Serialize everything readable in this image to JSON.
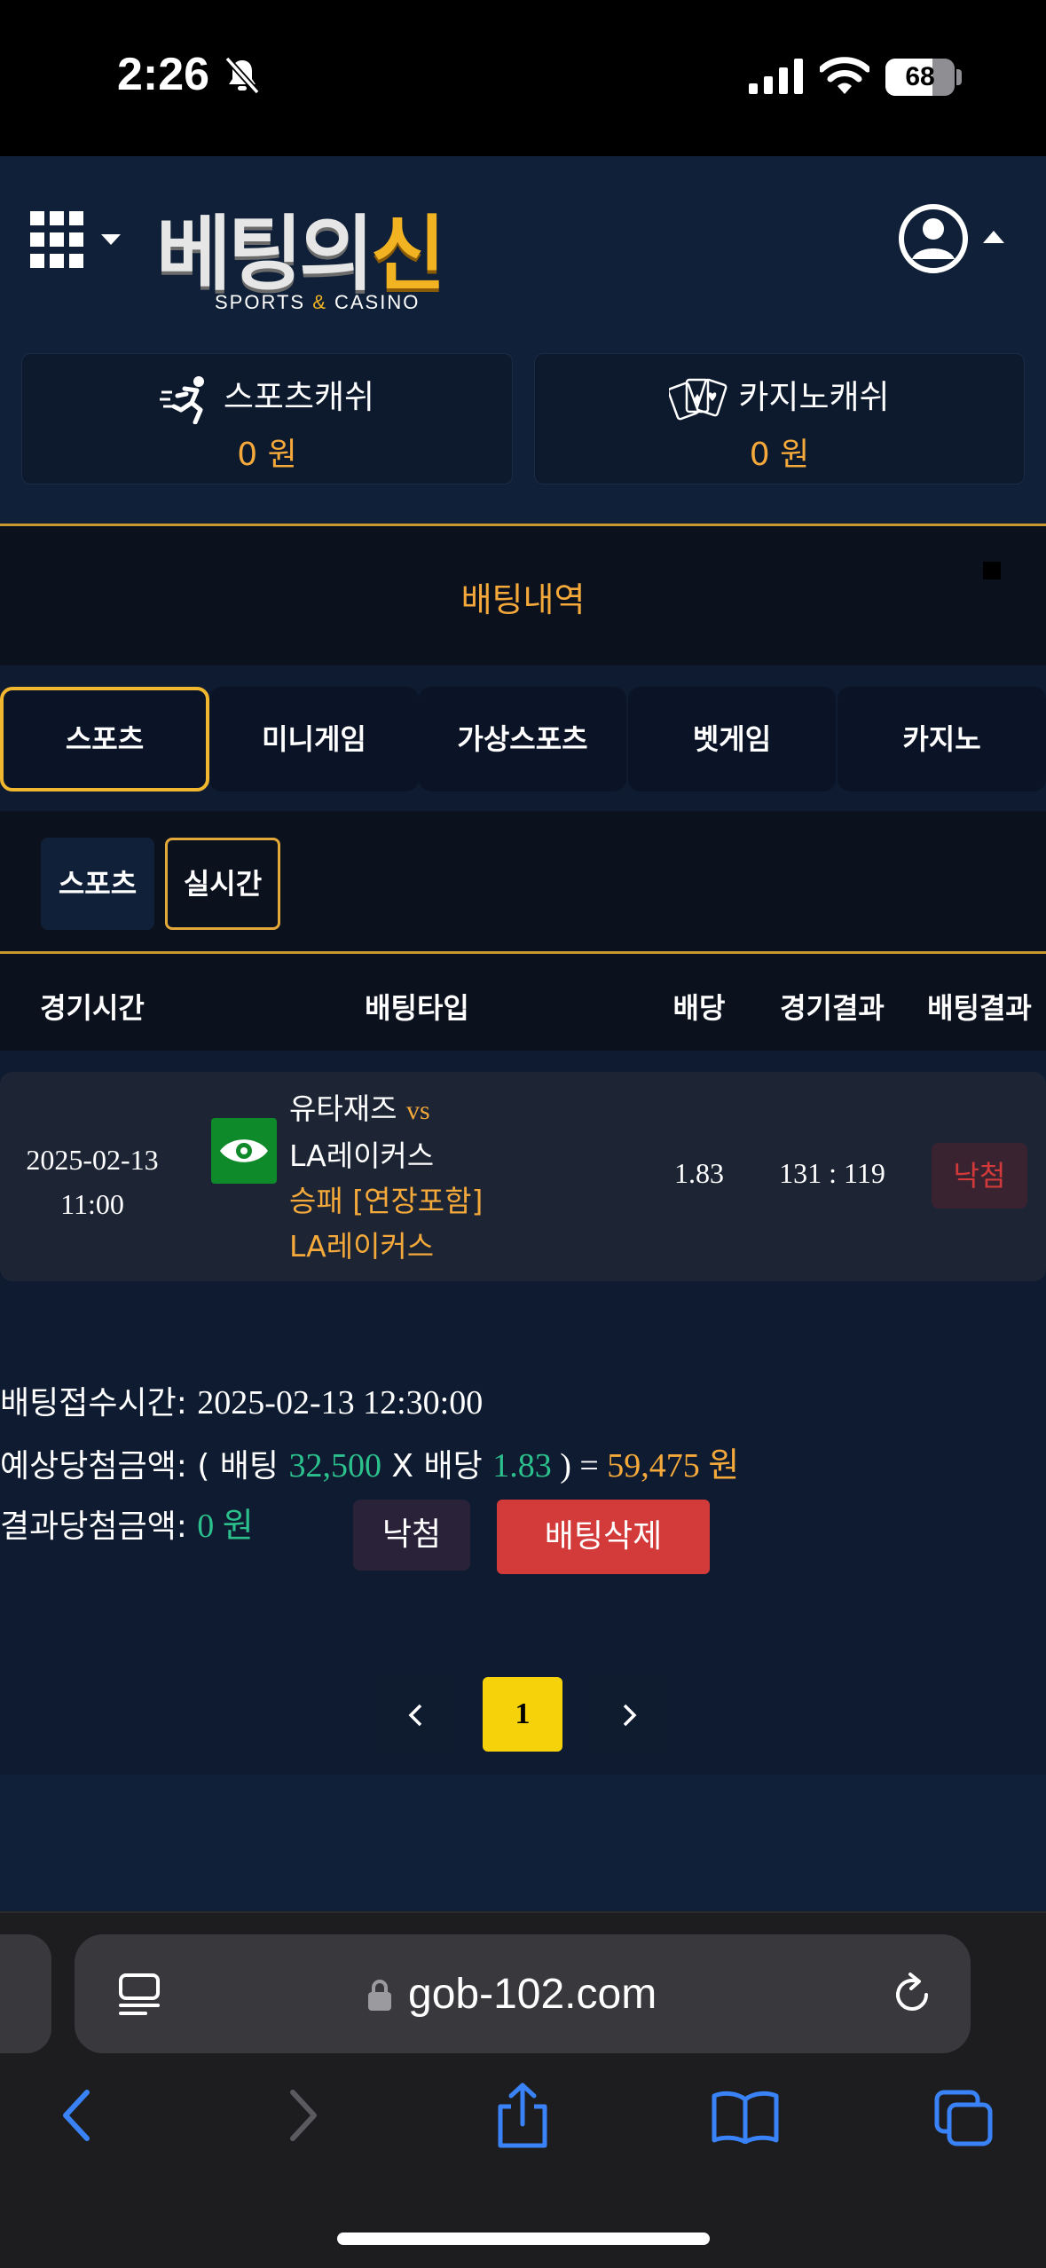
{
  "status_bar": {
    "time": "2:26",
    "battery": "68",
    "battery_level": 0.68
  },
  "header": {
    "logo_main_1": "베팅의",
    "logo_main_2": "신",
    "logo_sub_1": "SPORTS ",
    "logo_sub_amp": "&",
    "logo_sub_2": " CASINO",
    "sports_cash_label": "스포츠캐쉬",
    "sports_cash_value": "0 원",
    "casino_cash_label": "카지노캐쉬",
    "casino_cash_value": "0 원"
  },
  "page_title": "배팅내역",
  "tabs": [
    "스포츠",
    "미니게임",
    "가상스포츠",
    "벳게임",
    "카지노"
  ],
  "active_tab": "스포츠",
  "subtabs": [
    "스포츠",
    "실시간"
  ],
  "active_subtab": "실시간",
  "table": {
    "headers": [
      "경기시간",
      "배팅타입",
      "배당",
      "경기결과",
      "배팅결과"
    ],
    "rows": [
      {
        "date": "2025-02-13",
        "time": "11:00",
        "home": "유타재즈",
        "vs": "vs",
        "away": "LA레이커스",
        "bet_type": "승패 [연장포함]",
        "pick": "LA레이커스",
        "odds": "1.83",
        "score": "131 : 119",
        "result": "낙첨"
      }
    ]
  },
  "detail": {
    "received_label": "배팅접수시간: ",
    "received_value": "2025-02-13 12:30:00",
    "expected_label": "예상당첨금액: ",
    "expected_open": "( 배팅 ",
    "stake": "32,500",
    "times": " X 배당 ",
    "odds": "1.83",
    "close": " ) = ",
    "payout": "59,475 원",
    "final_label": "결과당첨금액: ",
    "final_value": "0 원",
    "result_button": "낙첨",
    "delete_button": "배팅삭제"
  },
  "pagination": {
    "current": "1"
  },
  "browser": {
    "url": "gob-102.com"
  },
  "colors": {
    "accent_gold": "#f5a93a",
    "active_border": "#f0b72f",
    "win_green": "#2cc08d",
    "loss_red": "#d23a3a",
    "page_bg": "#0e1b30"
  },
  "icons": [
    "bell-slash-icon",
    "signal-icon",
    "wifi-icon",
    "menu-grid-icon",
    "account-icon",
    "running-sports-icon",
    "cards-icon",
    "eye-icon",
    "chevron-left-icon",
    "chevron-right-icon",
    "reader-icon",
    "lock-icon",
    "reload-icon",
    "back-icon",
    "forward-icon",
    "share-icon",
    "bookmarks-icon",
    "tabs-icon"
  ]
}
